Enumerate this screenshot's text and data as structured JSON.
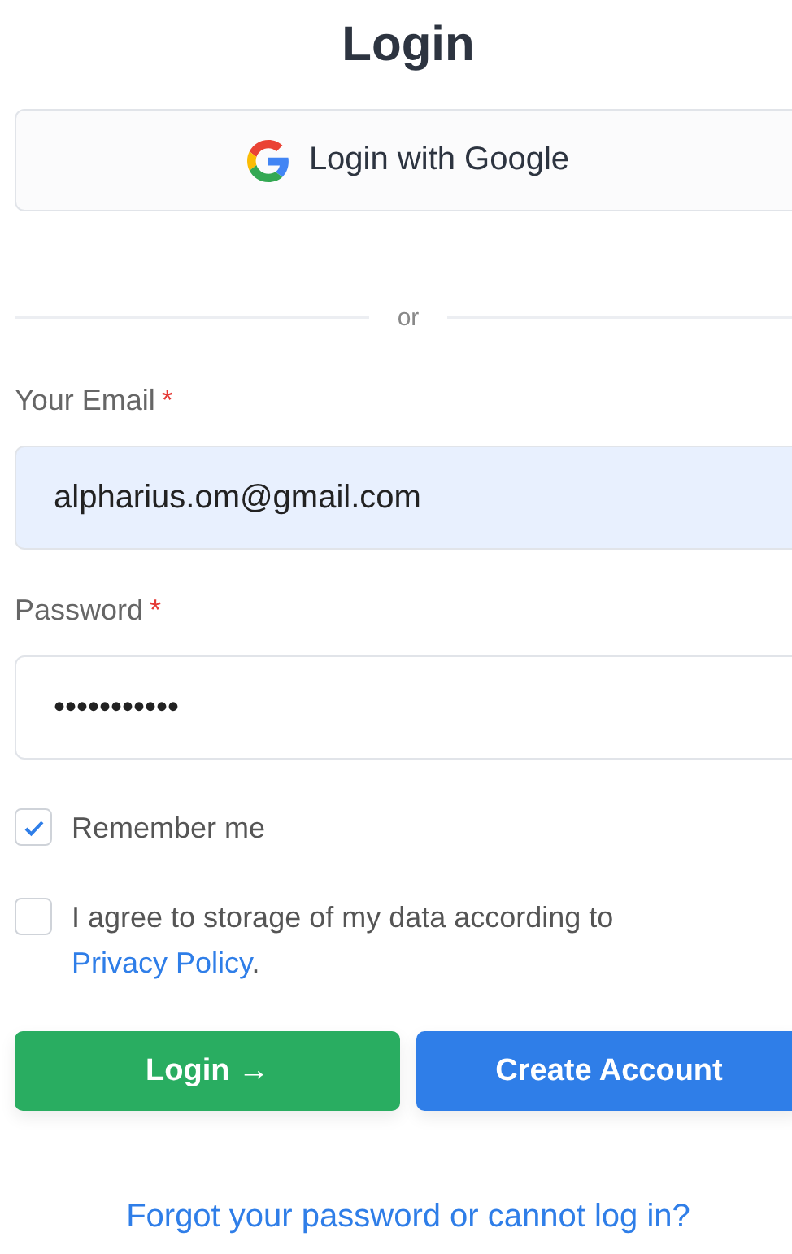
{
  "title": "Login",
  "google_button": {
    "label": "Login with Google"
  },
  "divider": {
    "label": "or"
  },
  "email": {
    "label": "Your Email",
    "required_mark": "*",
    "value": "alpharius.om@gmail.com",
    "autofilled": true
  },
  "password": {
    "label": "Password",
    "required_mark": "*",
    "value": "•••••••••••",
    "autofilled": false
  },
  "checkboxes": [
    {
      "text": "Remember me",
      "checked": true
    },
    {
      "text": "I agree to storage of my data according to ",
      "link": "Privacy Policy",
      "after": ".",
      "checked": false
    }
  ],
  "buttons": [
    {
      "label": "Login →",
      "kind": "primary"
    },
    {
      "label": "Create Account",
      "kind": "secondary"
    }
  ],
  "forgot_link": "Forgot your password or cannot log in?"
}
